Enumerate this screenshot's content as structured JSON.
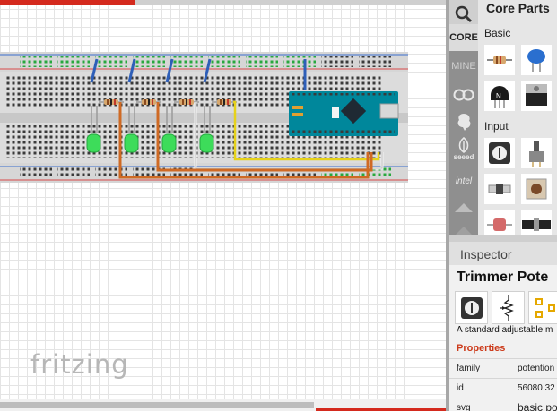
{
  "app": {
    "name": "Fritzing",
    "watermark": "fritzing"
  },
  "parts_panel": {
    "title": "Core Parts",
    "bins": [
      {
        "label": "",
        "icon": "search-icon"
      },
      {
        "label": "CORE",
        "icon": "core-bin"
      },
      {
        "label": "MINE",
        "icon": "mine-bin"
      },
      {
        "label": "",
        "icon": "arduino-icon"
      },
      {
        "label": "",
        "icon": "fritzing-icon"
      },
      {
        "label": "seeed",
        "icon": "seeed-icon"
      },
      {
        "label": "intel",
        "icon": "intel-icon"
      },
      {
        "label": "",
        "icon": "more-bins-icon"
      }
    ],
    "categories": [
      {
        "label": "Basic",
        "parts": [
          "resistor",
          "ceramic-capacitor",
          "transistor",
          "voltage-regulator"
        ]
      },
      {
        "label": "Input",
        "parts": [
          "trimmer-potentiometer",
          "rotary-potentiometer",
          "pushbutton",
          "tactile-button",
          "photocell",
          "slide-potentiometer"
        ]
      }
    ]
  },
  "inspector": {
    "title": "Inspector",
    "part_name": "Trimmer Pote",
    "description": "A standard adjustable m",
    "properties_label": "Properties",
    "properties": [
      {
        "key": "family",
        "value": "potention"
      },
      {
        "key": "id",
        "value": "56080 32"
      },
      {
        "key": "svg",
        "value": "basic po"
      }
    ]
  },
  "colors": {
    "accent_red": "#d42a1e",
    "breadboard": "#dcdcdc",
    "arduino_nano": "#00879b",
    "led": "#3ddc5a",
    "wire_blue": "#2e5fb8",
    "wire_orange": "#cf6a24",
    "wire_yellow": "#e6d21a",
    "properties_header": "#cc3a1a"
  }
}
